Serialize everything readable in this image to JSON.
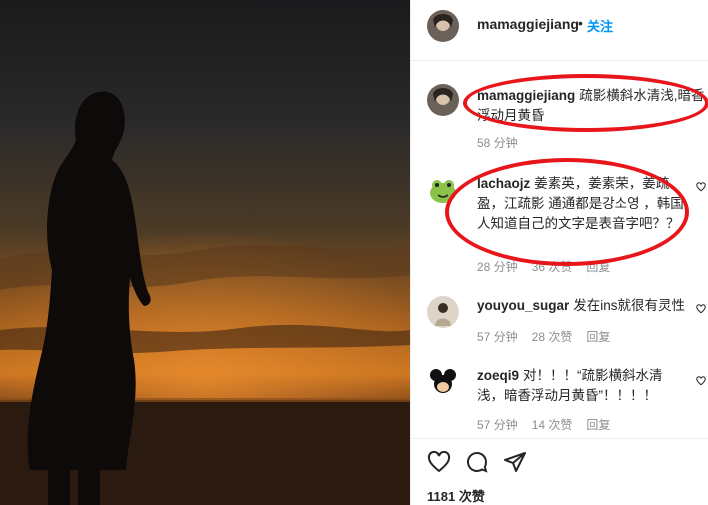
{
  "header": {
    "username": "mamaggiejiang",
    "dot": "•",
    "follow_label": "关注"
  },
  "caption": {
    "username": "mamaggiejiang",
    "text": "疏影横斜水清浅,暗香浮动月黄昏",
    "time": "58 分钟"
  },
  "comments": [
    {
      "username": "lachaojz",
      "text": "姜素英，姜素荣，姜疏盈，江疏影 通通都是강소영 ，韩国人知道自己的文字是表音字吧？？",
      "time": "28 分钟",
      "likes": "36 次赞",
      "reply": "回复"
    },
    {
      "username": "youyou_sugar",
      "text": "发在ins就很有灵性",
      "time": "57 分钟",
      "likes": "28 次赞",
      "reply": "回复"
    },
    {
      "username": "zoeqi9",
      "text": "对！！！“疏影横斜水清浅，暗香浮动月黄昏”！！！！",
      "time": "57 分钟",
      "likes": "14 次赞",
      "reply": "回复"
    }
  ],
  "actions": {
    "like_icon": "heart-icon",
    "comment_icon": "comment-icon",
    "share_icon": "share-icon"
  },
  "likes_count": "1181 次赞",
  "colors": {
    "follow": "#0095f6",
    "annotation": "#e8161b",
    "text": "#262626",
    "meta": "#8e8e8e"
  }
}
